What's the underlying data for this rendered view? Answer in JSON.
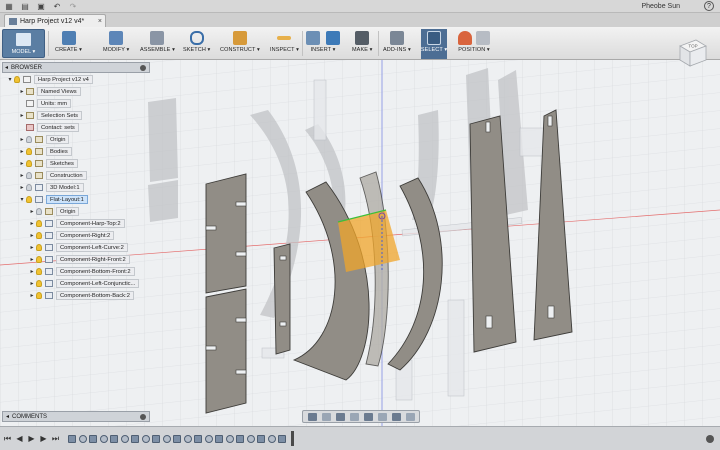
{
  "titlebar": {
    "user": "Pheobe Sun",
    "help": "?"
  },
  "tab": {
    "title": "Harp Project v12 v4*",
    "close": "×"
  },
  "ribbon": {
    "workspace": "MODEL ▾",
    "tools": [
      "CREATE ▾",
      "MODIFY ▾",
      "ASSEMBLE ▾",
      "SKETCH ▾",
      "CONSTRUCT ▾",
      "INSPECT ▾",
      "INSERT ▾",
      "MAKE ▾",
      "ADD-INS ▾",
      "SELECT ▾",
      "POSITION ▾"
    ]
  },
  "browser": {
    "title": "BROWSER",
    "items": [
      {
        "label": "Harp Project v12 v4",
        "depth": 0,
        "expander": "▾"
      },
      {
        "label": "Named Views",
        "depth": 1,
        "expander": "▸"
      },
      {
        "label": "Units: mm",
        "depth": 1,
        "expander": ""
      },
      {
        "label": "Selection Sets",
        "depth": 1,
        "expander": "▸"
      },
      {
        "label": "Contact: sets",
        "depth": 1,
        "expander": ""
      },
      {
        "label": "Origin",
        "depth": 1,
        "expander": "▸"
      },
      {
        "label": "Bodies",
        "depth": 1,
        "expander": "▸"
      },
      {
        "label": "Sketches",
        "depth": 1,
        "expander": "▸"
      },
      {
        "label": "Construction",
        "depth": 1,
        "expander": "▸"
      },
      {
        "label": "3D Model:1",
        "depth": 1,
        "expander": "▸"
      },
      {
        "label": "Flat-Layout:1",
        "depth": 1,
        "expander": "▾"
      },
      {
        "label": "Origin",
        "depth": 2,
        "expander": "▸"
      },
      {
        "label": "Component-Harp-Top:2",
        "depth": 2,
        "expander": "▸"
      },
      {
        "label": "Component-Right:2",
        "depth": 2,
        "expander": "▸"
      },
      {
        "label": "Component-Left-Curve:2",
        "depth": 2,
        "expander": "▸"
      },
      {
        "label": "Component-Right-Front:2",
        "depth": 2,
        "expander": "▸"
      },
      {
        "label": "Component-Bottom-Front:2",
        "depth": 2,
        "expander": "▸"
      },
      {
        "label": "Component-Left-Conjunctic...",
        "depth": 2,
        "expander": "▸"
      },
      {
        "label": "Component-Bottom-Back:2",
        "depth": 2,
        "expander": "▸"
      }
    ]
  },
  "comments": {
    "title": "COMMENTS"
  },
  "viewcube": {
    "face": "TOP"
  },
  "colors": {
    "accent": "#5b7ea3",
    "part_fill": "#928e88",
    "selection": "#f0a52a"
  }
}
